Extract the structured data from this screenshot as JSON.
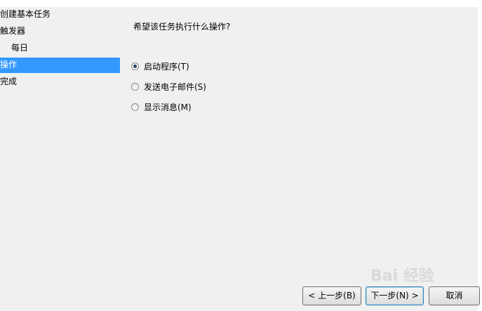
{
  "sidebar": {
    "items": [
      {
        "label": "创建基本任务"
      },
      {
        "label": "触发器"
      },
      {
        "label": "每日"
      },
      {
        "label": "操作"
      },
      {
        "label": "完成"
      }
    ]
  },
  "main": {
    "prompt": "希望该任务执行什么操作?",
    "options": [
      {
        "label": "启动程序(T)",
        "checked": true
      },
      {
        "label": "发送电子邮件(S)",
        "checked": false
      },
      {
        "label": "显示消息(M)",
        "checked": false
      }
    ]
  },
  "buttons": {
    "back": "< 上一步(B)",
    "next": "下一步(N) >",
    "cancel": "取消"
  },
  "watermark": "Bai 经验",
  "colors": {
    "selection": "#3399ff",
    "dialog_bg": "#f0f0f0"
  }
}
